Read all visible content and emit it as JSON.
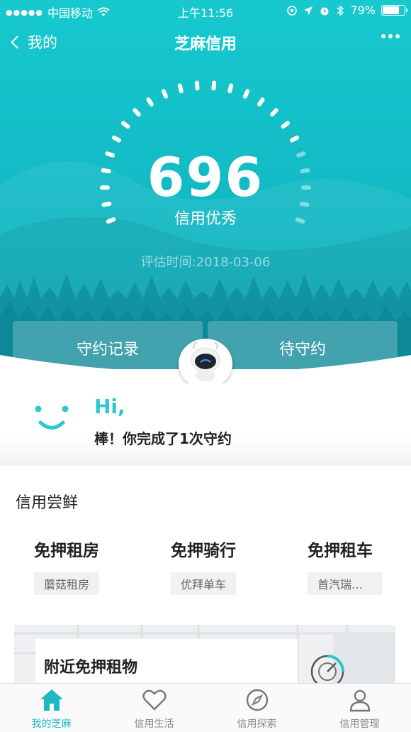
{
  "status_bar": {
    "carrier": "中国移动",
    "time": "上午11:56",
    "battery": "79%",
    "battery_level": 0.79
  },
  "nav": {
    "back_label": "我的",
    "title": "芝麻信用"
  },
  "credit": {
    "score": "696",
    "grade": "信用优秀",
    "eval_date": "评估时间:2018-03-06"
  },
  "tabs": {
    "left": "守约记录",
    "right": "待守约"
  },
  "greeting": {
    "hi": "Hi,",
    "message": "棒！你完成了1次守约"
  },
  "section": {
    "title": "信用尝鲜",
    "cards": [
      {
        "title": "免押租房",
        "tag": "蘑菇租房"
      },
      {
        "title": "免押骑行",
        "tag": "优拜单车"
      },
      {
        "title": "免押租车",
        "tag": "首汽瑞卡租..."
      }
    ]
  },
  "nearby": {
    "title": "附近免押租物"
  },
  "tabbar": [
    {
      "label": "我的芝麻",
      "icon": "home-icon",
      "active": true
    },
    {
      "label": "信用生活",
      "icon": "heart-icon",
      "active": false
    },
    {
      "label": "信用探索",
      "icon": "compass-icon",
      "active": false
    },
    {
      "label": "信用管理",
      "icon": "user-icon",
      "active": false
    }
  ],
  "colors": {
    "accent": "#1fb7c1",
    "hero_top": "#17c9cf",
    "hero_bottom": "#0aa9b8"
  }
}
